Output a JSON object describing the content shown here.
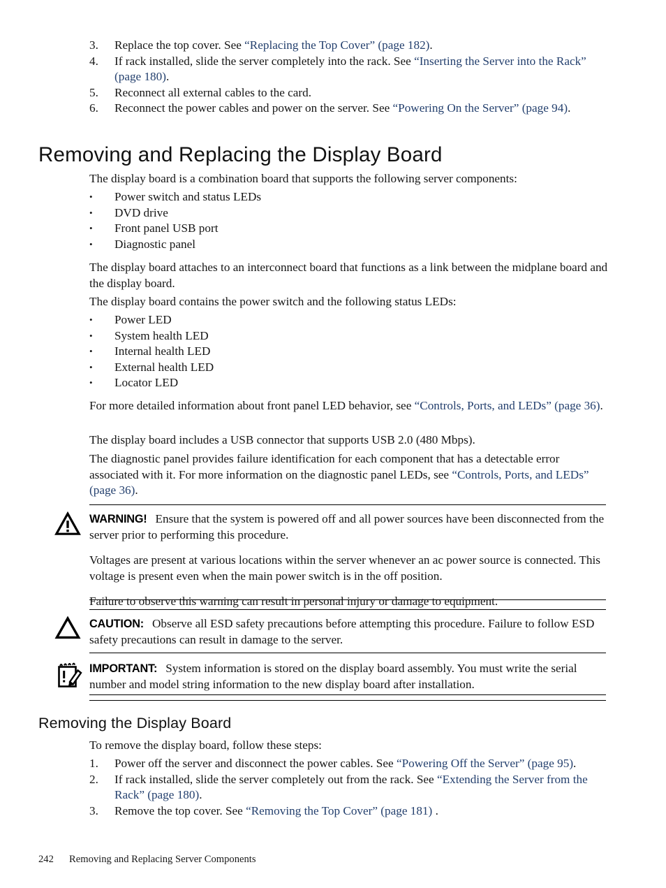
{
  "document": {
    "footer": {
      "page_number": "242",
      "chapter_title": "Removing and Replacing Server Components"
    }
  },
  "top_steps": {
    "items": [
      {
        "marker": "3.",
        "parts": [
          {
            "text": "Replace the top cover. See ",
            "link": false
          },
          {
            "text": "“Replacing the Top Cover” (page 182)",
            "link": true
          },
          {
            "text": ".",
            "link": false
          }
        ]
      },
      {
        "marker": "4.",
        "parts": [
          {
            "text": "If rack installed, slide the server completely into the rack. See ",
            "link": false
          },
          {
            "text": "“Inserting the Server into the Rack” (page 180)",
            "link": true
          },
          {
            "text": ".",
            "link": false
          }
        ]
      },
      {
        "marker": "5.",
        "parts": [
          {
            "text": "Reconnect all external cables to the card.",
            "link": false
          }
        ]
      },
      {
        "marker": "6.",
        "parts": [
          {
            "text": "Reconnect the power cables and power on the server. See ",
            "link": false
          },
          {
            "text": "“Powering On the Server” (page 94)",
            "link": true
          },
          {
            "text": ".",
            "link": false
          }
        ]
      }
    ]
  },
  "section": {
    "heading": "Removing and Replacing the Display Board",
    "intro": "The display board is a combination board that supports the following server components:",
    "components": [
      {
        "marker": "•",
        "parts": [
          {
            "text": "Power switch and status LEDs",
            "link": false
          }
        ]
      },
      {
        "marker": "•",
        "parts": [
          {
            "text": "DVD drive",
            "link": false
          }
        ]
      },
      {
        "marker": "•",
        "parts": [
          {
            "text": "Front panel USB port",
            "link": false
          }
        ]
      },
      {
        "marker": "•",
        "parts": [
          {
            "text": "Diagnostic panel",
            "link": false
          }
        ]
      }
    ],
    "interconnect_para": "The display board attaches to an interconnect board that functions as a link between the midplane board and the display board.",
    "leds_intro": "The display board contains the power switch and the following status LEDs:",
    "leds": [
      {
        "marker": "•",
        "parts": [
          {
            "text": "Power LED",
            "link": false
          }
        ]
      },
      {
        "marker": "•",
        "parts": [
          {
            "text": "System health LED",
            "link": false
          }
        ]
      },
      {
        "marker": "•",
        "parts": [
          {
            "text": "Internal health LED",
            "link": false
          }
        ]
      },
      {
        "marker": "•",
        "parts": [
          {
            "text": "External health LED",
            "link": false
          }
        ]
      },
      {
        "marker": "•",
        "parts": [
          {
            "text": "Locator LED",
            "link": false
          }
        ]
      }
    ],
    "led_behavior_para": {
      "parts": [
        {
          "text": "For more detailed information about front panel LED behavior, see ",
          "link": false
        },
        {
          "text": "“Controls, Ports, and LEDs” (page 36)",
          "link": true
        },
        {
          "text": ".",
          "link": false
        }
      ]
    },
    "usb_para": "The display board includes a USB connector that supports USB 2.0 (480 Mbps).",
    "diagnostic_para": {
      "parts": [
        {
          "text": "The diagnostic panel provides failure identification for each component that has a detectable error associated with it. For more information on the diagnostic panel LEDs, see ",
          "link": false
        },
        {
          "text": "“Controls, Ports, and LEDs” (page 36)",
          "link": true
        },
        {
          "text": ".",
          "link": false
        }
      ]
    }
  },
  "admonitions": {
    "warning": {
      "icon": "warning-triangle-exclamation-icon",
      "label": "WARNING!",
      "paragraphs": [
        "Ensure that the system is powered off and all power sources have been disconnected from the server prior to performing this procedure.",
        "Voltages are present at various locations within the server whenever an ac power source is connected. This voltage is present even when the main power switch is in the off position.",
        "Failure to observe this warning can result in personal injury or damage to equipment."
      ]
    },
    "caution": {
      "icon": "caution-triangle-icon",
      "label": "CAUTION:",
      "paragraphs": [
        "Observe all ESD safety precautions before attempting this procedure. Failure to follow ESD safety precautions can result in damage to the server."
      ]
    },
    "important": {
      "icon": "important-notepad-pencil-icon",
      "label": "IMPORTANT:",
      "paragraphs": [
        "System information is stored on the display board assembly. You must write the serial number and model string information to the new display board after installation."
      ]
    }
  },
  "subsection": {
    "heading": "Removing the Display Board",
    "intro": "To remove the display board, follow these steps:",
    "steps": [
      {
        "marker": "1.",
        "parts": [
          {
            "text": "Power off the server and disconnect the power cables. See ",
            "link": false
          },
          {
            "text": "“Powering Off the Server” (page 95)",
            "link": true
          },
          {
            "text": ".",
            "link": false
          }
        ]
      },
      {
        "marker": "2.",
        "parts": [
          {
            "text": "If rack installed, slide the server completely out from the rack. See ",
            "link": false
          },
          {
            "text": "“Extending the Server from the Rack” (page 180)",
            "link": true
          },
          {
            "text": ".",
            "link": false
          }
        ]
      },
      {
        "marker": "3.",
        "parts": [
          {
            "text": "Remove the top cover. See ",
            "link": false
          },
          {
            "text": "“Removing the Top Cover” (page 181)",
            "link": true
          },
          {
            "text": " .",
            "link": false
          }
        ]
      }
    ]
  },
  "colors": {
    "link": "#24406e",
    "text": "#161616",
    "rule": "#000000"
  }
}
